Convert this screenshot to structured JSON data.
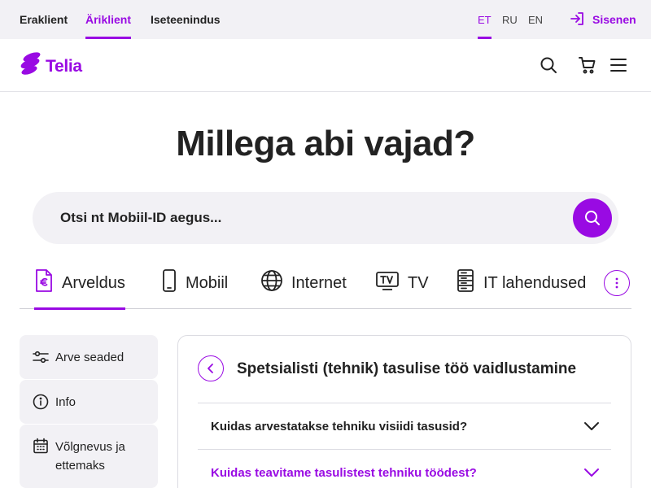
{
  "topbar": {
    "segments": [
      "Eraklient",
      "Äriklient",
      "Iseteenindus"
    ],
    "active_segment": "Äriklient",
    "languages": [
      "ET",
      "RU",
      "EN"
    ],
    "active_language": "ET",
    "signin_label": "Sisenen"
  },
  "header": {
    "logo_text": "Telia",
    "icons": [
      "search-icon",
      "cart-icon",
      "menu-icon"
    ]
  },
  "hero": {
    "title": "Millega abi vajad?",
    "search_placeholder": "Otsi nt Mobiil-ID aegus..."
  },
  "tabs": [
    {
      "label": "Arveldus",
      "icon": "invoice-euro-icon",
      "active": true
    },
    {
      "label": "Mobiil",
      "icon": "mobile-icon",
      "active": false
    },
    {
      "label": "Internet",
      "icon": "globe-icon",
      "active": false
    },
    {
      "label": "TV",
      "icon": "tv-icon",
      "active": false
    },
    {
      "label": "IT lahendused",
      "icon": "server-icon",
      "active": false
    }
  ],
  "sidebar": {
    "items": [
      {
        "label": "Arve seaded",
        "icon": "sliders-icon"
      },
      {
        "label": "Info",
        "icon": "info-icon"
      },
      {
        "label": "Võlgnevus ja ettemaks",
        "icon": "calendar-icon"
      }
    ]
  },
  "article": {
    "title": "Spetsialisti (tehnik) tasulise töö vaidlustamine",
    "questions": [
      {
        "text": "Kuidas arvestatakse tehniku visiidi tasusid?",
        "highlighted": false
      },
      {
        "text": "Kuidas teavitame tasulistest tehniku töödest?",
        "highlighted": true
      }
    ]
  },
  "colors": {
    "brand": "#990ae3",
    "surface": "#f2f1f5",
    "text": "#222222"
  }
}
